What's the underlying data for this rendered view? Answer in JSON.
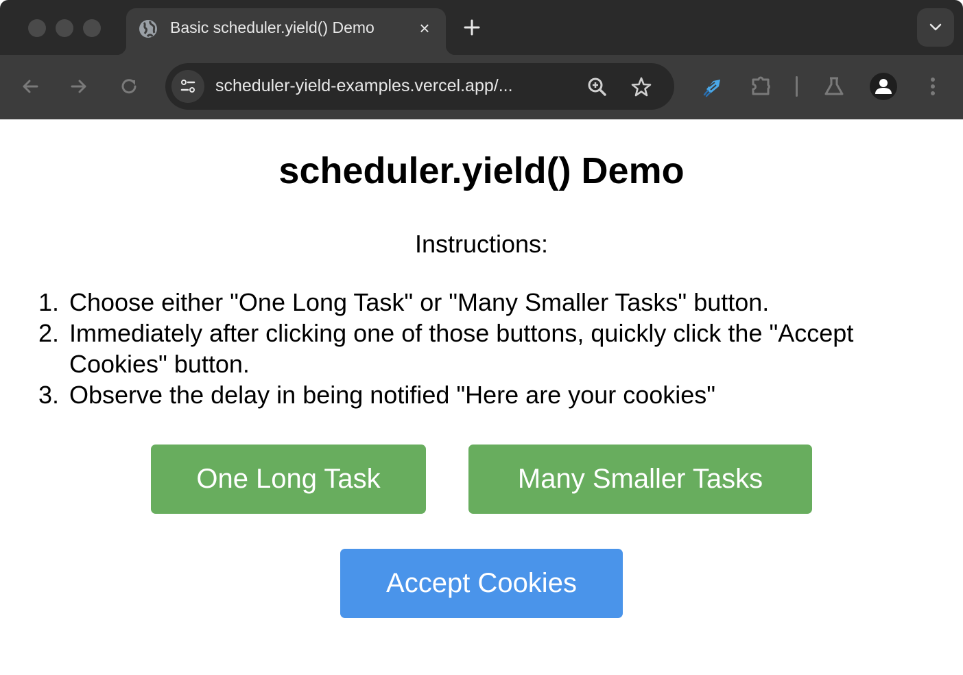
{
  "browser": {
    "tab": {
      "title": "Basic scheduler.yield() Demo",
      "favicon": "globe-icon",
      "close_label": "×"
    },
    "new_tab_icon": "plus-icon",
    "tab_search_icon": "chevron-down-icon",
    "toolbar": {
      "back_icon": "arrow-left-icon",
      "forward_icon": "arrow-right-icon",
      "reload_icon": "reload-icon",
      "site_info_icon": "tune-icon",
      "url": "scheduler-yield-examples.vercel.app/...",
      "zoom_icon": "zoom-in-icon",
      "bookmark_icon": "star-icon",
      "extensions": [
        "rocket-extension-icon",
        "puzzle-icon",
        "flask-icon"
      ],
      "profile_icon": "person-icon",
      "menu_icon": "more-vertical-icon"
    },
    "colors": {
      "tabstrip": "#2a2a2a",
      "toolbar": "#3c3c3c",
      "omnibox": "#282828",
      "extension_accent": "#4aa8e8"
    }
  },
  "page": {
    "title": "scheduler.yield() Demo",
    "instructions_heading": "Instructions:",
    "steps": [
      {
        "num": "1.",
        "text": "Choose either \"One Long Task\" or \"Many Smaller Tasks\" button."
      },
      {
        "num": "2.",
        "text": "Immediately after clicking one of those buttons, quickly click the \"Accept Cookies\" button."
      },
      {
        "num": "3.",
        "text": "Observe the delay in being notified \"Here are your cookies\""
      }
    ],
    "buttons": {
      "one_long_task": "One Long Task",
      "many_smaller_tasks": "Many Smaller Tasks",
      "accept_cookies": "Accept Cookies"
    },
    "colors": {
      "task_button": "#68ad5e",
      "accept_button": "#4a94ea",
      "button_text": "#ffffff"
    }
  }
}
